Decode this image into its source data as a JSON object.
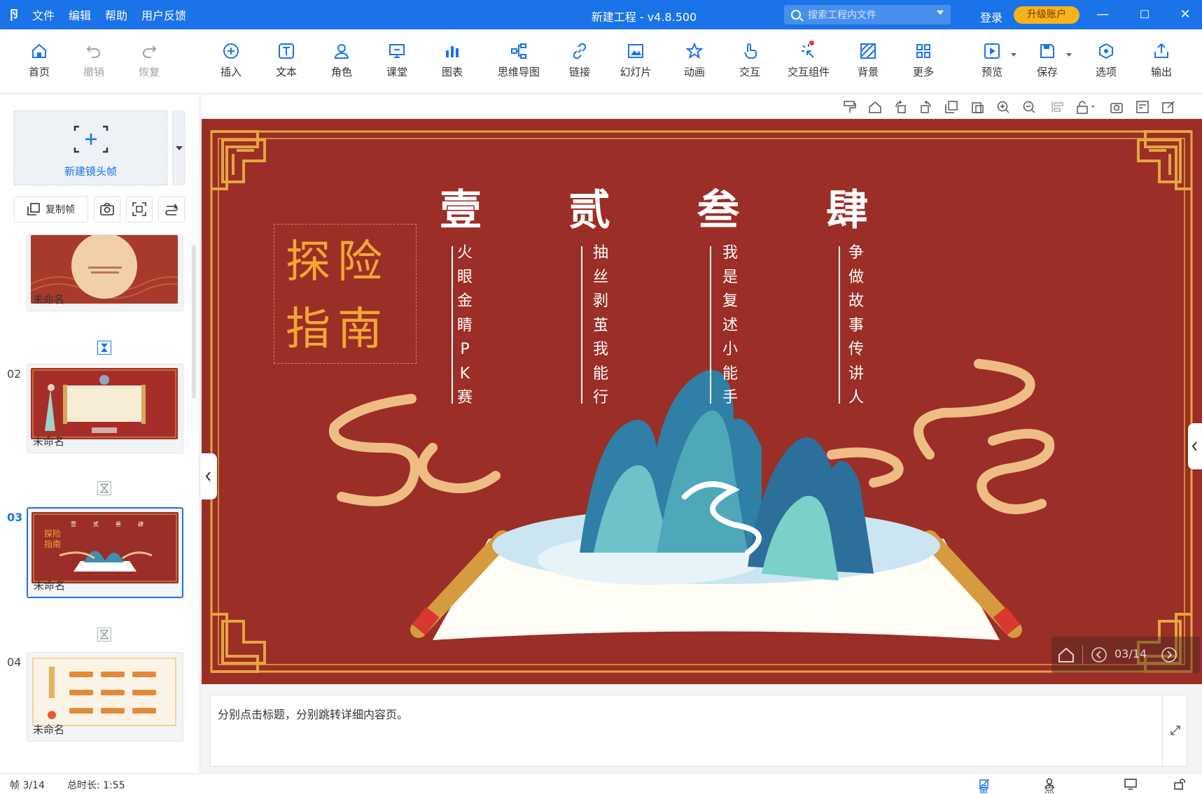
{
  "titlebar": {
    "app_icon": "卪",
    "menu": [
      "文件",
      "编辑",
      "帮助",
      "用户反馈"
    ],
    "title": "新建工程 - v4.8.500",
    "search_placeholder": "搜索工程内文件",
    "login": "登录",
    "upgrade": "升级账户",
    "minimize": "—",
    "maximize": "☐",
    "close": "✕"
  },
  "toolbar": {
    "items": [
      {
        "label": "首页",
        "icon": "home-icon"
      },
      {
        "label": "撤销",
        "icon": "undo-icon"
      },
      {
        "label": "恢复",
        "icon": "redo-icon"
      },
      {
        "label": "插入",
        "icon": "plus-circle-icon"
      },
      {
        "label": "文本",
        "icon": "text-icon"
      },
      {
        "label": "角色",
        "icon": "character-icon"
      },
      {
        "label": "课堂",
        "icon": "classroom-icon"
      },
      {
        "label": "图表",
        "icon": "chart-icon"
      },
      {
        "label": "思维导图",
        "icon": "mindmap-icon"
      },
      {
        "label": "链接",
        "icon": "link-icon"
      },
      {
        "label": "幻灯片",
        "icon": "slideshow-icon"
      },
      {
        "label": "动画",
        "icon": "star-icon"
      },
      {
        "label": "交互",
        "icon": "hand-icon"
      },
      {
        "label": "交互组件",
        "icon": "interactive-icon"
      },
      {
        "label": "背景",
        "icon": "background-icon"
      },
      {
        "label": "更多",
        "icon": "grid-icon"
      },
      {
        "label": "预览",
        "icon": "preview-icon"
      },
      {
        "label": "保存",
        "icon": "save-icon"
      },
      {
        "label": "选项",
        "icon": "options-icon"
      },
      {
        "label": "输出",
        "icon": "export-icon"
      }
    ]
  },
  "leftpanel": {
    "new_frame": "新建镜头帧",
    "copy_frame": "复制帧",
    "slides": [
      {
        "number": "",
        "name": "未命名"
      },
      {
        "number": "02",
        "name": "未命名"
      },
      {
        "number": "03",
        "name": "未命名"
      },
      {
        "number": "04",
        "name": "未命名"
      }
    ]
  },
  "slide": {
    "brand_line1": "探险",
    "brand_line2": "指南",
    "columns": [
      {
        "title": "壹",
        "text": "火\n眼\n金\n睛\nP\nK\n赛"
      },
      {
        "title": "贰",
        "text": "抽\n丝\n剥\n茧\n我\n能\n行"
      },
      {
        "title": "叁",
        "text": "我\n是\n复\n述\n小\n能\n手"
      },
      {
        "title": "肆",
        "text": "争\n做\n故\n事\n传\n讲\n人"
      }
    ],
    "colors": {
      "background": "#9b2e26",
      "gold": "#e4a63e",
      "title": "#ffffff"
    }
  },
  "player": {
    "page": "03/14"
  },
  "notes": {
    "text": "分别点击标题，分别跳转详细内容页。"
  },
  "statusbar": {
    "frame": "帧 3/14",
    "duration": "总时长: 1:55",
    "notes_btn": "备注",
    "rollcall_btn": "点名"
  }
}
